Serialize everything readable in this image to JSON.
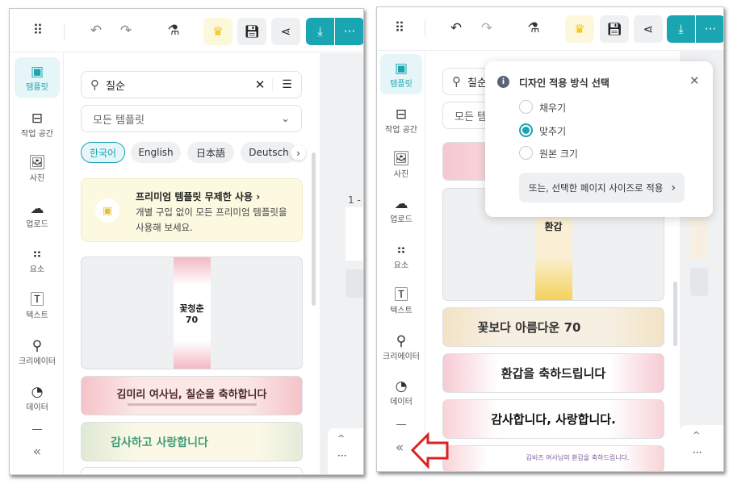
{
  "colors": {
    "accent": "#1aa5b3",
    "premium_bg": "#fdf9e1",
    "crown": "#f2c200",
    "arrow": "#e02020"
  },
  "toolbar": {
    "icons": [
      "grid-icon",
      "undo-icon",
      "redo-icon",
      "flask-icon",
      "crown-icon",
      "save-icon",
      "share-icon",
      "download-icon",
      "more-icon"
    ],
    "more_label": "···"
  },
  "sidebar": {
    "items": [
      {
        "label": "템플릿",
        "icon": "template-icon"
      },
      {
        "label": "작업 공간",
        "icon": "archive-icon"
      },
      {
        "label": "사진",
        "icon": "image-icon"
      },
      {
        "label": "업로드",
        "icon": "upload-cloud-icon"
      },
      {
        "label": "요소",
        "icon": "shapes-icon"
      },
      {
        "label": "텍스트",
        "icon": "text-icon"
      },
      {
        "label": "크리에이터",
        "icon": "creator-icon"
      },
      {
        "label": "데이터",
        "icon": "chart-icon"
      }
    ],
    "collapse": "«"
  },
  "search": {
    "value": "칠순"
  },
  "filter": {
    "selected": "모든 템플릿"
  },
  "languages": [
    "한국어",
    "English",
    "日本語",
    "Deutsch"
  ],
  "premium": {
    "title": "프리미엄 템플릿 무제한 사용",
    "desc1": "개별 구입 없이 모든 프리미엄 템플릿을",
    "desc2": "사용해 보세요."
  },
  "canvas": {
    "page_label": "1 -",
    "more": "···",
    "up": "^"
  },
  "left_templates": [
    {
      "title": "꽃청춘 70"
    },
    {
      "title": "김미리 여사님, 칠순을 축하합니다"
    },
    {
      "title": "감사하고 사랑합니다"
    }
  ],
  "right_templates": [
    {
      "title": "환갑"
    },
    {
      "title": "꽃보다 아름다운 70"
    },
    {
      "title": "환갑을 축하드립니다"
    },
    {
      "title": "감사합니다, 사랑합니다."
    },
    {
      "title": "김비즈 여사님의 환갑을 축하드립니다."
    }
  ],
  "popup": {
    "title": "디자인 적용 방식 선택",
    "options": [
      {
        "label": "채우기",
        "selected": false
      },
      {
        "label": "맞추기",
        "selected": true
      },
      {
        "label": "원본 크기",
        "selected": false
      }
    ],
    "page_size_button": "또는, 선택한 페이지 사이즈로 적용"
  }
}
